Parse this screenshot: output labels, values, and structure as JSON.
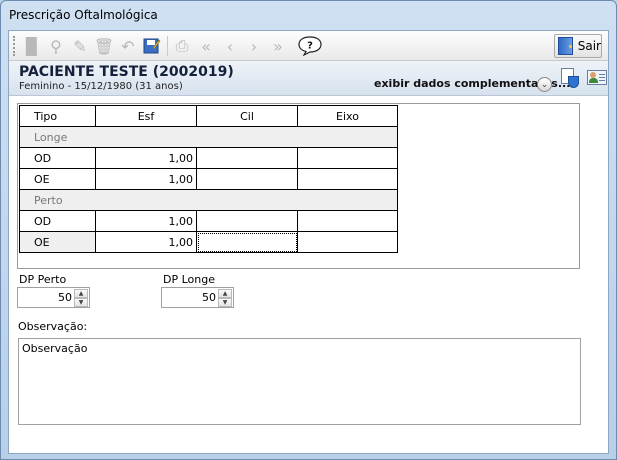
{
  "window": {
    "title": "Prescrição Oftalmológica"
  },
  "toolbar": {
    "exit_label": "Sair",
    "icons": [
      "new-icon",
      "find-icon",
      "edit-icon",
      "delete-icon",
      "undo-icon",
      "save-icon",
      "print-icon",
      "first-icon",
      "previous-icon",
      "next-icon",
      "last-icon",
      "help-icon"
    ]
  },
  "patient": {
    "name": "PACIENTE TESTE (2002019)",
    "info": "Feminino - 15/12/1980 (31 anos)",
    "extra_link": "exibir dados complementares..."
  },
  "grid": {
    "headers": {
      "tipo": "Tipo",
      "esf": "Esf",
      "cil": "Cil",
      "eixo": "Eixo"
    },
    "groups": [
      {
        "label": "Longe",
        "rows": [
          {
            "tipo": "OD",
            "esf": "1,00",
            "cil": "",
            "eixo": ""
          },
          {
            "tipo": "OE",
            "esf": "1,00",
            "cil": "",
            "eixo": ""
          }
        ]
      },
      {
        "label": "Perto",
        "rows": [
          {
            "tipo": "OD",
            "esf": "1,00",
            "cil": "",
            "eixo": ""
          },
          {
            "tipo": "OE",
            "esf": "1,00",
            "cil": "",
            "eixo": ""
          }
        ]
      }
    ]
  },
  "dp": {
    "perto": {
      "label": "DP Perto",
      "value": "50"
    },
    "longe": {
      "label": "DP Longe",
      "value": "50"
    }
  },
  "observacao": {
    "label": "Observação:",
    "text": "Observação"
  }
}
